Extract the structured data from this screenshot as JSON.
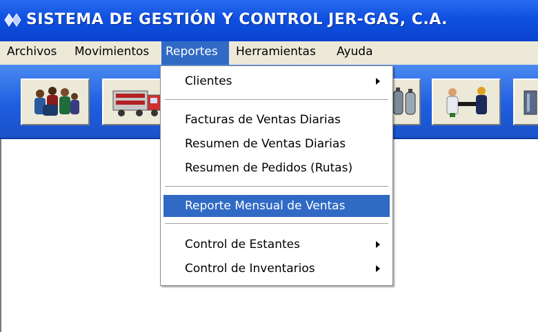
{
  "window": {
    "title": "SISTEMA DE GESTIÓN Y CONTROL JER-GAS, C.A.",
    "title_icon": "app-diamond-icon"
  },
  "menubar": {
    "items": [
      {
        "label": "Archivos"
      },
      {
        "label": "Movimientos"
      },
      {
        "label": "Reportes"
      },
      {
        "label": "Herramientas"
      },
      {
        "label": "Ayuda"
      }
    ],
    "active": "Reportes"
  },
  "toolbar": {
    "buttons": [
      {
        "icon": "people-group-icon"
      },
      {
        "icon": "gas-truck-icon"
      },
      {
        "icon": "gas-cylinders-icon"
      },
      {
        "icon": "handshake-workers-icon"
      },
      {
        "icon": "cylinder-partial-icon"
      }
    ]
  },
  "reportes_menu": {
    "items": [
      {
        "label": "Clientes",
        "submenu": true
      },
      {
        "label": "Facturas de Ventas Diarias"
      },
      {
        "label": "Resumen de Ventas Diarias"
      },
      {
        "label": "Resumen de Pedidos (Rutas)"
      },
      {
        "label": "Reporte Mensual de Ventas",
        "highlighted": true
      },
      {
        "label": "Control de Estantes",
        "submenu": true
      },
      {
        "label": "Control de Inventarios",
        "submenu": true
      }
    ]
  },
  "colors": {
    "title_bar": "#0f4fe0",
    "menu_bar": "#ece9d8",
    "highlight": "#316ac5",
    "toolbar": "#1f5ee0"
  }
}
